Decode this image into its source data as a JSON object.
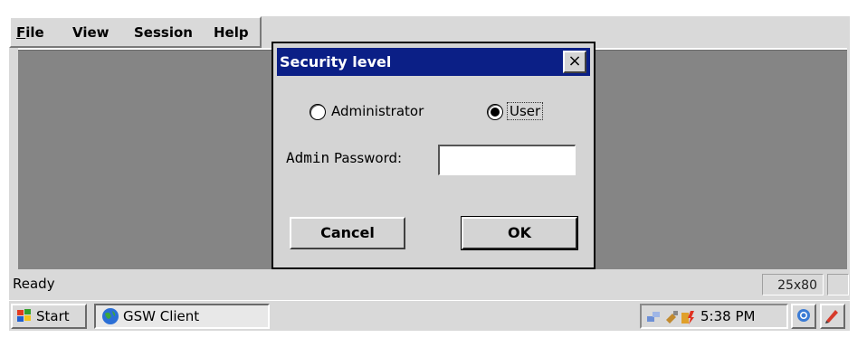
{
  "menubar": {
    "items": [
      "File",
      "View",
      "Session",
      "Help"
    ]
  },
  "dialog": {
    "title": "Security level",
    "close_glyph": "×",
    "radio_admin": "Administrator",
    "radio_user": "User",
    "selected": "User",
    "password_label_prefix": "Admin",
    "password_label_suffix": "Password:",
    "password_value": "",
    "cancel_label": "Cancel",
    "ok_label": "OK"
  },
  "statusbar": {
    "status": "Ready",
    "dimensions": "25x80"
  },
  "taskbar": {
    "start_label": "Start",
    "task_label": "GSW Client",
    "clock": "5:38 PM"
  },
  "icons": {
    "start": "windows-flag-icon",
    "task": "globe-icon",
    "tray1": "network-icon",
    "tray2": "usb-icon",
    "tray3": "power-icon",
    "tray_btn1": "refresh-icon",
    "tray_btn2": "pen-icon"
  },
  "colors": {
    "titlebar": "#0b1f86",
    "client": "#858585",
    "chrome": "#d9d9d9"
  }
}
